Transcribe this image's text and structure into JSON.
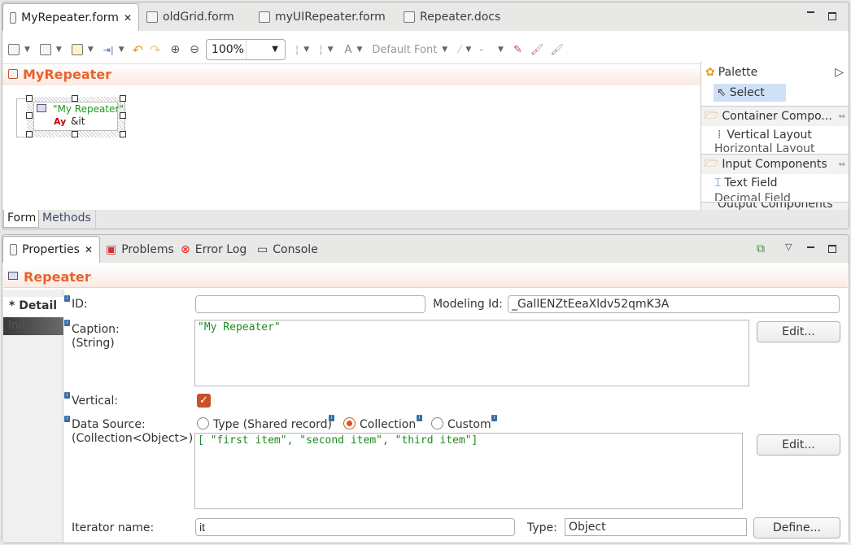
{
  "editor": {
    "tabs": [
      {
        "label": "MyRepeater.form",
        "active": true,
        "closable": true
      },
      {
        "label": "oldGrid.form"
      },
      {
        "label": "myUIRepeater.form"
      },
      {
        "label": "Repeater.docs"
      }
    ],
    "toolbar": {
      "zoom": "100%",
      "font_letter": "A",
      "font": "Default Font",
      "line_style": "-"
    },
    "form_title": "MyRepeater",
    "canvas": {
      "repeater_caption": "\"My Repeater\"",
      "label_icon_text": "Ay",
      "label_binding": "&it"
    },
    "bottom_tabs": [
      "Form",
      "Methods"
    ]
  },
  "palette": {
    "title": "Palette",
    "select": "Select",
    "groups": [
      {
        "label": "Container Compo...",
        "items": [
          "Vertical Layout",
          "Horizontal Layout"
        ]
      },
      {
        "label": "Input Components",
        "items": [
          "Text Field",
          "Decimal Field"
        ]
      },
      {
        "label": "Output Components",
        "items": []
      }
    ]
  },
  "views": {
    "tabs": [
      {
        "label": "Properties",
        "active": true,
        "closable": true
      },
      {
        "label": "Problems"
      },
      {
        "label": "Error Log"
      },
      {
        "label": "Console"
      }
    ]
  },
  "properties": {
    "title": "Repeater",
    "side_tabs": [
      "* Detail",
      "Init"
    ],
    "id_label": "ID:",
    "id_value": "",
    "modeling_id_label": "Modeling Id:",
    "modeling_id_value": "_GallENZtEeaXldv52qmK3A",
    "caption_label": "Caption:",
    "caption_type": "(String)",
    "caption_value": "\"My Repeater\"",
    "edit_label": "Edit...",
    "vertical_label": "Vertical:",
    "vertical_checked": true,
    "data_source_label": "Data Source:",
    "data_source_type": "(Collection<Object>)",
    "data_source_options": [
      "Type (Shared record)",
      "Collection",
      "Custom"
    ],
    "data_source_selected": "Collection",
    "data_source_value": "[ \"first item\", \"second item\", \"third item\"]",
    "iterator_label": "Iterator name:",
    "iterator_value": "it",
    "type_label": "Type:",
    "type_value": "Object",
    "define_label": "Define..."
  },
  "colors": {
    "accent": "#e8642c",
    "selection": "#cfe1f7",
    "checkbox": "#c8502a"
  }
}
